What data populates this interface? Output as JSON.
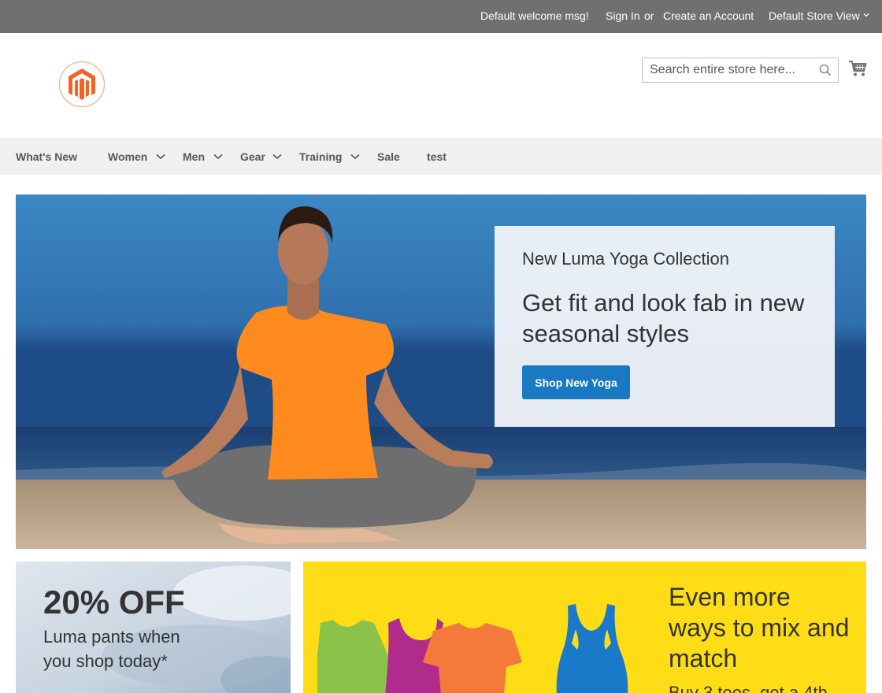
{
  "topbar": {
    "welcome": "Default welcome msg!",
    "sign_in": "Sign In",
    "or": "or",
    "create_account": "Create an Account",
    "store_view": "Default Store View"
  },
  "search": {
    "placeholder": "Search entire store here..."
  },
  "icons": {
    "logo": "magento-logo",
    "search": "search-icon",
    "cart": "cart-icon",
    "chevron": "chevron-down-icon"
  },
  "nav": {
    "items": [
      {
        "label": "What's New",
        "has_submenu": false
      },
      {
        "label": "Women",
        "has_submenu": true
      },
      {
        "label": "Men",
        "has_submenu": true
      },
      {
        "label": "Gear",
        "has_submenu": true
      },
      {
        "label": "Training",
        "has_submenu": true
      },
      {
        "label": "Sale",
        "has_submenu": false
      },
      {
        "label": "test",
        "has_submenu": false
      }
    ]
  },
  "hero": {
    "subtitle": "New Luma Yoga Collection",
    "title": "Get fit and look fab in new seasonal styles",
    "button": "Shop New Yoga"
  },
  "promo_pants": {
    "title": "20% OFF",
    "text": "Luma pants when you shop today*"
  },
  "promo_mix": {
    "title": "Even more ways to mix and match",
    "text": "Buy 3 tees, get a 4th"
  },
  "colors": {
    "topbar_bg": "#6e716e",
    "nav_bg": "#f0f0f0",
    "accent_blue": "#1979c3",
    "promo_yellow": "#ffdd16",
    "brand_orange": "#f26322"
  }
}
